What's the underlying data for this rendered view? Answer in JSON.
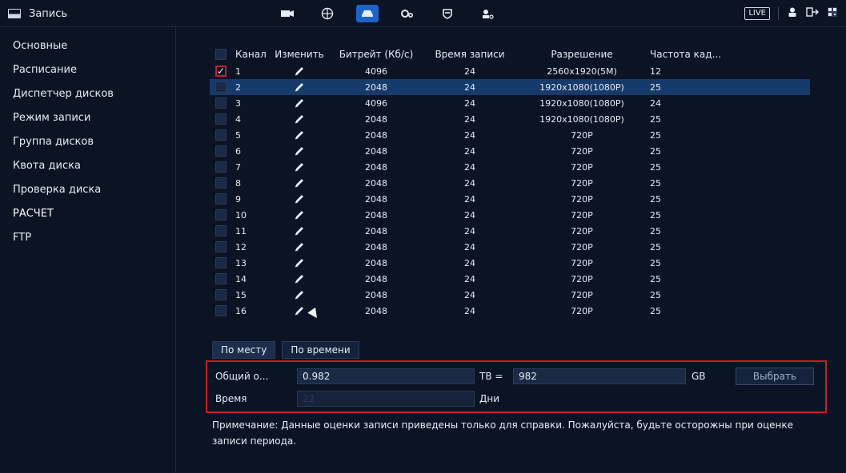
{
  "app": {
    "title": "Запись"
  },
  "top_right": {
    "live": "LIVE"
  },
  "sidebar": {
    "items": [
      {
        "label": "Основные"
      },
      {
        "label": "Расписание"
      },
      {
        "label": "Диспетчер дисков"
      },
      {
        "label": "Режим записи"
      },
      {
        "label": "Группа дисков"
      },
      {
        "label": "Квота диска"
      },
      {
        "label": "Проверка диска"
      },
      {
        "label": "РАСЧЕТ"
      },
      {
        "label": "FTP"
      }
    ]
  },
  "table": {
    "headers": [
      "Канал",
      "Изменить",
      "Битрейт (Кб/с)",
      "Время записи",
      "Разрешение",
      "Частота кад..."
    ],
    "rows": [
      {
        "ch": "1",
        "bitrate": "4096",
        "time": "24",
        "res": "2560x1920(5M)",
        "fps": "12",
        "checked": true
      },
      {
        "ch": "2",
        "bitrate": "2048",
        "time": "24",
        "res": "1920x1080(1080P)",
        "fps": "25",
        "checked": false
      },
      {
        "ch": "3",
        "bitrate": "4096",
        "time": "24",
        "res": "1920x1080(1080P)",
        "fps": "24",
        "checked": false
      },
      {
        "ch": "4",
        "bitrate": "2048",
        "time": "24",
        "res": "1920x1080(1080P)",
        "fps": "25",
        "checked": false
      },
      {
        "ch": "5",
        "bitrate": "2048",
        "time": "24",
        "res": "720P",
        "fps": "25",
        "checked": false
      },
      {
        "ch": "6",
        "bitrate": "2048",
        "time": "24",
        "res": "720P",
        "fps": "25",
        "checked": false
      },
      {
        "ch": "7",
        "bitrate": "2048",
        "time": "24",
        "res": "720P",
        "fps": "25",
        "checked": false
      },
      {
        "ch": "8",
        "bitrate": "2048",
        "time": "24",
        "res": "720P",
        "fps": "25",
        "checked": false
      },
      {
        "ch": "9",
        "bitrate": "2048",
        "time": "24",
        "res": "720P",
        "fps": "25",
        "checked": false
      },
      {
        "ch": "10",
        "bitrate": "2048",
        "time": "24",
        "res": "720P",
        "fps": "25",
        "checked": false
      },
      {
        "ch": "11",
        "bitrate": "2048",
        "time": "24",
        "res": "720P",
        "fps": "25",
        "checked": false
      },
      {
        "ch": "12",
        "bitrate": "2048",
        "time": "24",
        "res": "720P",
        "fps": "25",
        "checked": false
      },
      {
        "ch": "13",
        "bitrate": "2048",
        "time": "24",
        "res": "720P",
        "fps": "25",
        "checked": false
      },
      {
        "ch": "14",
        "bitrate": "2048",
        "time": "24",
        "res": "720P",
        "fps": "25",
        "checked": false
      },
      {
        "ch": "15",
        "bitrate": "2048",
        "time": "24",
        "res": "720P",
        "fps": "25",
        "checked": false
      },
      {
        "ch": "16",
        "bitrate": "2048",
        "time": "24",
        "res": "720P",
        "fps": "25",
        "checked": false
      }
    ]
  },
  "tabs": [
    {
      "label": "По месту"
    },
    {
      "label": "По времени"
    }
  ],
  "estimate": {
    "total_label": "Общий о...",
    "total_value": "0.982",
    "tb_label": "TB =",
    "gb_value": "982",
    "gb_label": "GB",
    "choose_button": "Выбрать",
    "time_label": "Время",
    "days_value": "22",
    "days_label": "Дни"
  },
  "note": {
    "text": "Примечание: Данные оценки записи приведены только для справки. Пожалуйста, будьте осторожны при оценке записи периода."
  },
  "colors": {
    "accent_red": "#c71b2a",
    "accent_blue": "#1c64c8",
    "row_highlight": "#163a6a"
  }
}
